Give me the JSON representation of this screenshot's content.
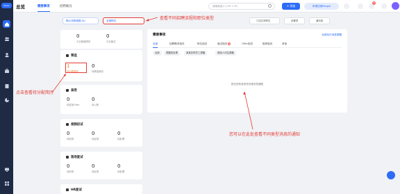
{
  "nav": {
    "logo": "Moka",
    "items": [
      {
        "icon": "home-icon",
        "active": true
      },
      {
        "icon": "people-icon",
        "active": false
      },
      {
        "icon": "user-icon",
        "active": false
      },
      {
        "icon": "briefcase-icon",
        "active": false
      },
      {
        "icon": "book-icon",
        "active": false
      },
      {
        "icon": "pie-chart-icon",
        "active": false
      },
      {
        "icon": "monitor-icon",
        "active": false
      },
      {
        "icon": "grid-icon",
        "active": false
      }
    ]
  },
  "topbar": {
    "title": "总览",
    "tabs": [
      "需要事项",
      "招聘概况"
    ],
    "search_placeholder": "搜索候选人 (CM + M)",
    "add_label": "+ 添加",
    "trial_label": "申请试用People",
    "badge_count": "9"
  },
  "filters": {
    "selector1": "默认流程视图 (8)",
    "selector2": "全部职位",
    "right_tools": [
      "门店共享职位",
      "设置项",
      "通讯录"
    ]
  },
  "cards": {
    "apply": {
      "stats": [
        {
          "n": "0",
          "l": "今日新增简历"
        },
        {
          "n": "0",
          "l": "今日面试"
        }
      ]
    },
    "screen": {
      "title": "筛选",
      "stats": [
        {
          "n": "1",
          "l": "待分配简历"
        },
        {
          "n": "0",
          "l": "待筛选简历"
        }
      ]
    },
    "hire": {
      "title": "录用",
      "stats": [
        {
          "n": "0",
          "l": "待发放Offer"
        },
        {
          "n": "0",
          "l": "待入职"
        }
      ]
    },
    "video": {
      "title": "视频初试",
      "stats": [
        {
          "n": "0",
          "l": "待安排"
        },
        {
          "n": "0",
          "l": "待反馈"
        },
        {
          "n": "0",
          "l": "待处理"
        }
      ]
    },
    "onsite": {
      "title": "现场复试",
      "stats": [
        {
          "n": "0",
          "l": "待安排"
        },
        {
          "n": "0",
          "l": "待反馈"
        },
        {
          "n": "0",
          "l": "待处理"
        }
      ]
    },
    "hr": {
      "title": "HR面试"
    }
  },
  "panel": {
    "title": "需要事项",
    "link": "全部站内消息提醒",
    "tabs": [
      {
        "label": "全部",
        "badge": ""
      },
      {
        "label": "招聘需求相关",
        "badge": ""
      },
      {
        "label": "职位相关",
        "badge": ""
      },
      {
        "label": "面试相关",
        "badge": "2"
      },
      {
        "label": "Offer相关",
        "badge": ""
      },
      {
        "label": "推荐相关",
        "badge": ""
      },
      {
        "label": "其他",
        "badge": ""
      }
    ],
    "chips": [
      "全部",
      "提醒您处理",
      "某某在职员工提醒",
      "候选人评估提醒"
    ],
    "empty_text": "您还没有收到任何相关的通知"
  },
  "annotations": {
    "top": "查看不同招聘流程和职位类型",
    "left": "点击查看待分配简历",
    "bottom": "您可以在此处查看不同类型消息的通知"
  }
}
